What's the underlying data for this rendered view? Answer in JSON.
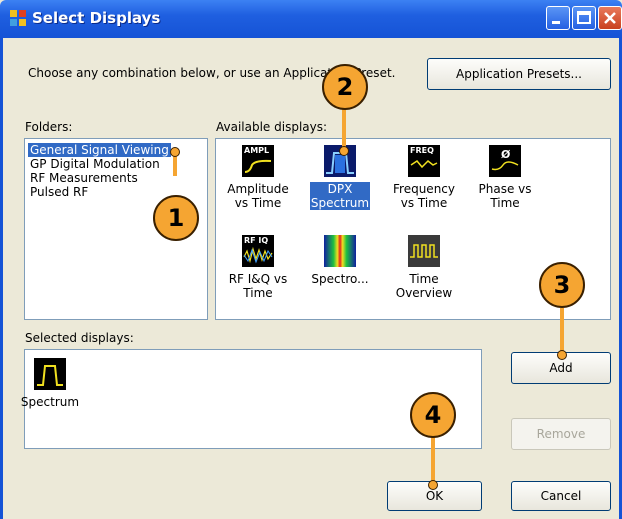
{
  "window": {
    "title": "Select Displays"
  },
  "intro_text": "Choose any combination below, or use an Application Preset.",
  "buttons": {
    "presets": "Application Presets...",
    "add": "Add",
    "remove": "Remove",
    "ok": "OK",
    "cancel": "Cancel"
  },
  "folders": {
    "label": "Folders:",
    "items": [
      "General Signal Viewing",
      "GP Digital Modulation",
      "RF Measurements",
      "Pulsed RF"
    ],
    "selected": "General Signal Viewing"
  },
  "available": {
    "label": "Available displays:",
    "items": [
      {
        "label": "Amplitude\nvs Time",
        "icon": "amplitude-vs-time-icon",
        "icon_text": "AMPL"
      },
      {
        "label": "DPX\nSpectrum",
        "icon": "dpx-spectrum-icon",
        "selected": true
      },
      {
        "label": "Frequency\nvs Time",
        "icon": "frequency-vs-time-icon",
        "icon_text": "FREQ"
      },
      {
        "label": "Phase vs\nTime",
        "icon": "phase-vs-time-icon",
        "icon_text": "Ø"
      },
      {
        "label": "RF I&Q vs\nTime",
        "icon": "rf-iq-vs-time-icon",
        "icon_text": "RF IQ"
      },
      {
        "label": "Spectro...",
        "icon": "spectrogram-icon"
      },
      {
        "label": "Time\nOverview",
        "icon": "time-overview-icon"
      }
    ]
  },
  "selected_displays": {
    "label": "Selected displays:",
    "items": [
      {
        "label": "Spectrum",
        "icon": "spectrum-icon"
      }
    ]
  },
  "callouts": [
    "1",
    "2",
    "3",
    "4"
  ],
  "colors": {
    "titlebar": "#1553d6",
    "selection": "#316ac5",
    "callout": "#f5a532"
  }
}
